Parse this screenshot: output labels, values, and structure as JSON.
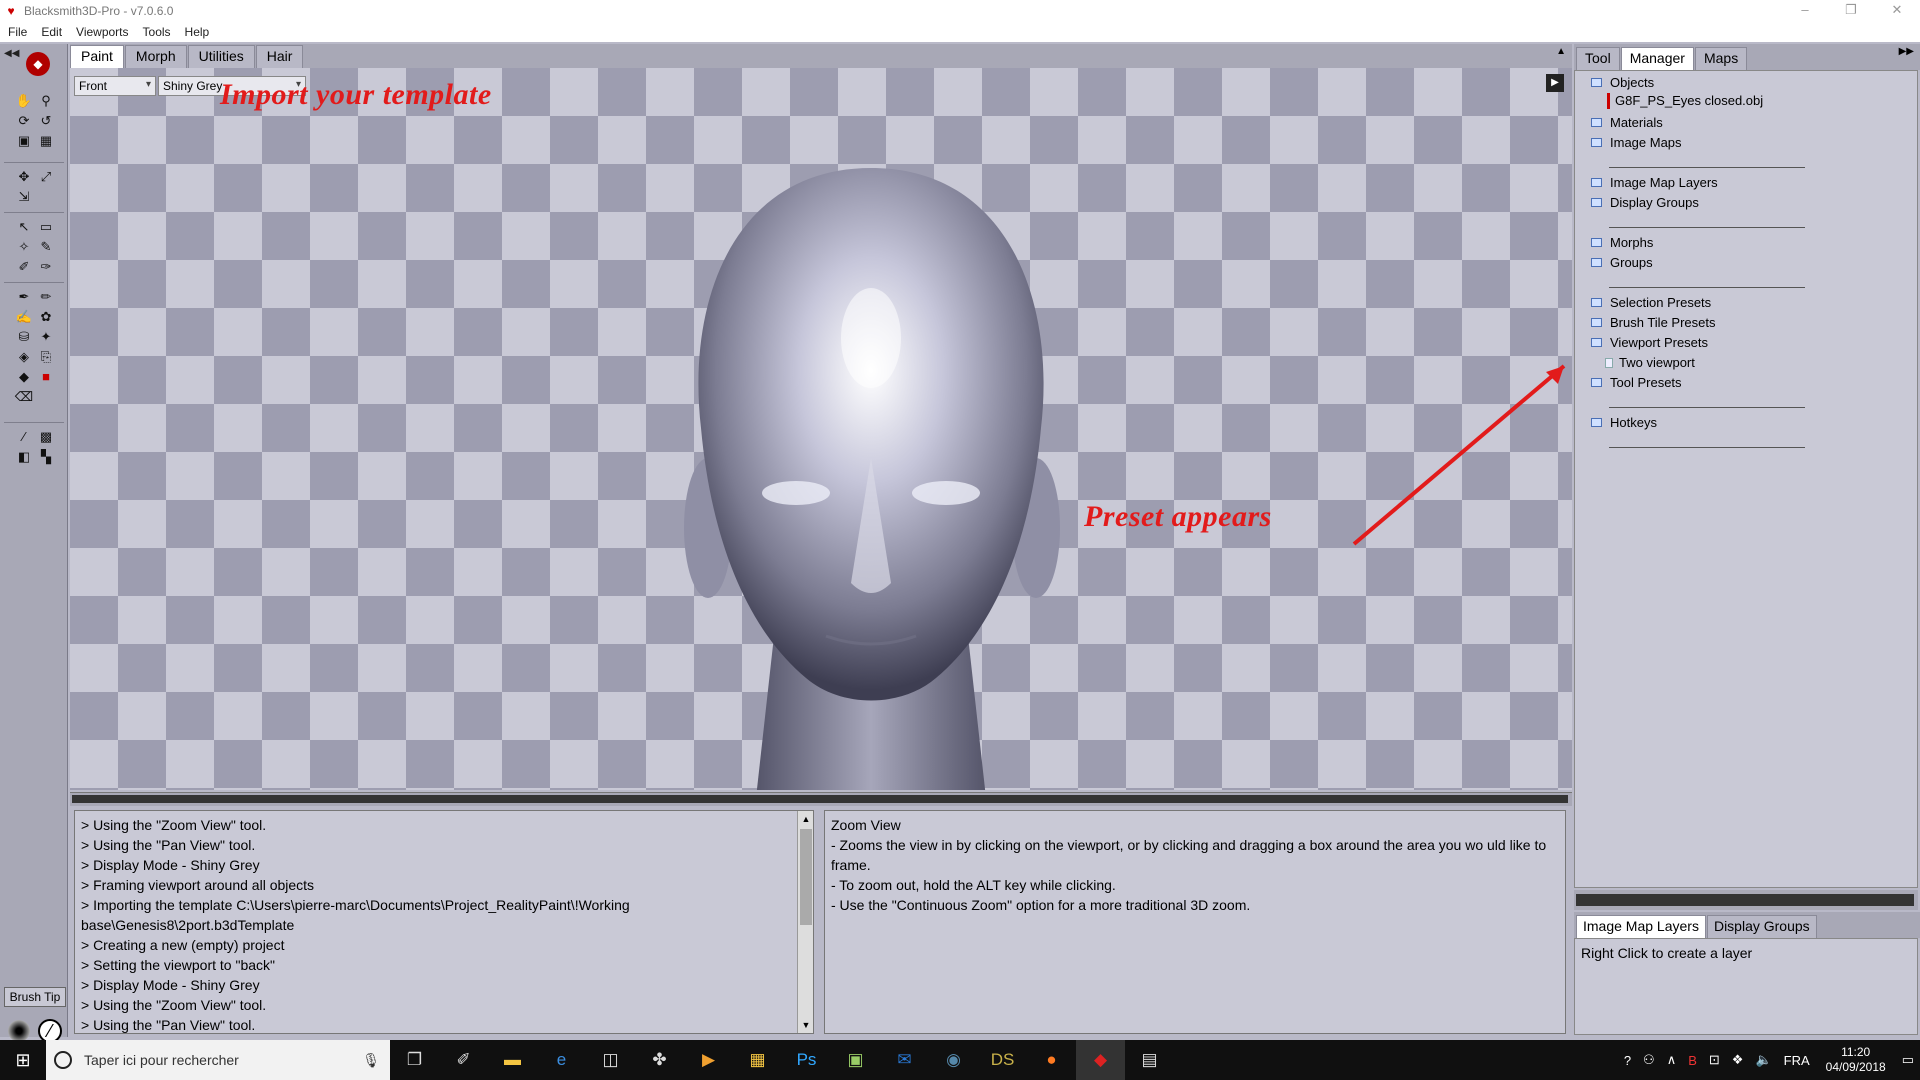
{
  "window": {
    "title": "Blacksmith3D-Pro - v7.0.6.0",
    "controls": [
      "–",
      "❐",
      "✕"
    ]
  },
  "menu": [
    "File",
    "Edit",
    "Viewports",
    "Tools",
    "Help"
  ],
  "left_toolbar": {
    "brush_tip_label": "Brush Tip"
  },
  "top_tabs": [
    "Paint",
    "Morph",
    "Utilities",
    "Hair"
  ],
  "viewport": {
    "view_select": "Front",
    "shading_select": "Shiny Grey",
    "annotation_import": "Import your template",
    "annotation_preset": "Preset appears"
  },
  "log_lines": [
    "> Using the \"Zoom View\" tool.",
    "> Using the \"Pan View\" tool.",
    "> Display Mode - Shiny Grey",
    "> Framing viewport around all objects",
    "> Importing the template C:\\Users\\pierre-marc\\Documents\\Project_RealityPaint\\!Working base\\Genesis8\\2port.b3dTemplate",
    "> Creating a new (empty) project",
    "> Setting the viewport to \"back\"",
    "> Display Mode - Shiny Grey",
    "> Using the \"Zoom View\" tool.",
    "> Using the \"Pan View\" tool."
  ],
  "help": {
    "title": "Zoom View",
    "lines": [
      "- Zooms the view in by clicking on the viewport, or by clicking and dragging a box around the area you wo uld like to frame.",
      "- To zoom out, hold the ALT key while clicking.",
      "- Use the \"Continuous Zoom\" option for a more traditional 3D zoom."
    ]
  },
  "right_tabs": [
    "Tool",
    "Manager",
    "Maps"
  ],
  "manager_tree": {
    "objects": "Objects",
    "object_child": "G8F_PS_Eyes closed.obj",
    "materials": "Materials",
    "image_maps": "Image Maps",
    "image_map_layers": "Image Map Layers",
    "display_groups": "Display Groups",
    "morphs": "Morphs",
    "groups": "Groups",
    "selection_presets": "Selection Presets",
    "brush_tile_presets": "Brush Tile Presets",
    "viewport_presets": "Viewport Presets",
    "viewport_preset_child": "Two viewport",
    "tool_presets": "Tool Presets",
    "hotkeys": "Hotkeys"
  },
  "lower_tabs": [
    "Image Map Layers",
    "Display Groups"
  ],
  "layer_hint": "Right Click to create a layer",
  "taskbar": {
    "search_placeholder": "Taper ici pour rechercher",
    "language": "FRA",
    "time": "11:20",
    "date": "04/09/2018"
  },
  "colors": {
    "annotation": "#e21b1b",
    "checker_dark": "#9d9db0",
    "checker_light": "#c9c9d6"
  }
}
